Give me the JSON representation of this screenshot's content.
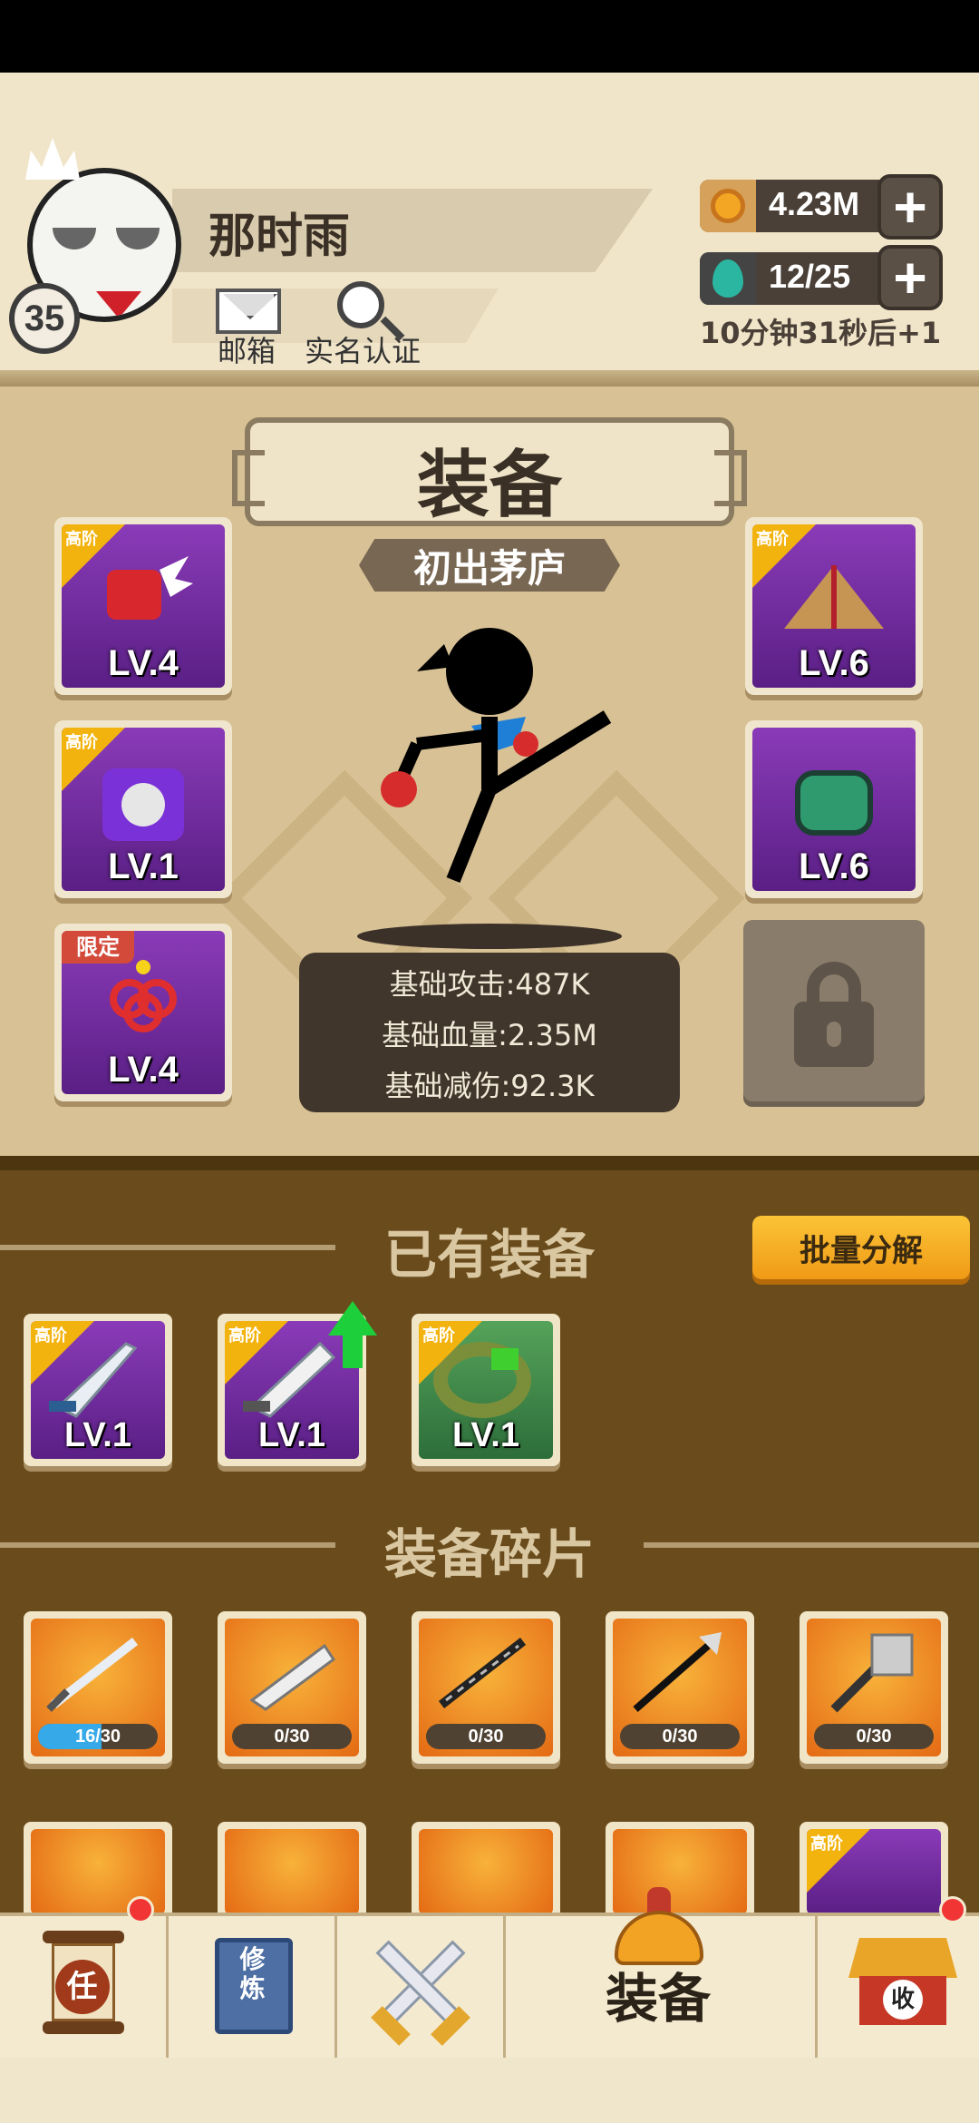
{
  "player": {
    "name": "那时雨",
    "level": "35",
    "mail_label": "邮箱",
    "verify_label": "实名认证"
  },
  "resources": {
    "gold": "4.23M",
    "gems": "12/25",
    "timer": "10分钟31秒后+1"
  },
  "equipment_panel": {
    "title": "装备",
    "rank": "初出茅庐",
    "left_slots": [
      {
        "badge": "高阶",
        "level": "LV.4",
        "icon": "red-gauntlet-icon"
      },
      {
        "badge": "高阶",
        "level": "LV.1",
        "icon": "purple-armor-icon"
      },
      {
        "badge": "限定",
        "level": "LV.4",
        "icon": "chinese-knot-icon"
      }
    ],
    "right_slots": [
      {
        "badge": "高阶",
        "level": "LV.6",
        "icon": "straw-hat-icon"
      },
      {
        "badge": "",
        "level": "LV.6",
        "icon": "green-bracer-icon"
      }
    ],
    "stats": [
      "基础攻击:487K",
      "基础血量:2.35M",
      "基础减伤:92.3K"
    ]
  },
  "owned": {
    "title": "已有装备",
    "batch_button": "批量分解",
    "items": [
      {
        "badge": "高阶",
        "level": "LV.1",
        "icon": "saber-icon"
      },
      {
        "badge": "高阶",
        "level": "LV.1",
        "icon": "saber-icon",
        "upgrade": true
      },
      {
        "badge": "高阶",
        "level": "LV.1",
        "icon": "jade-bracelet-icon"
      }
    ]
  },
  "fragments": {
    "title": "装备碎片",
    "items": [
      {
        "progress": "16/30",
        "fraction": 0.533,
        "icon": "sword-icon"
      },
      {
        "progress": "0/30",
        "fraction": 0,
        "icon": "broad-blade-icon"
      },
      {
        "progress": "0/30",
        "fraction": 0,
        "icon": "staff-icon"
      },
      {
        "progress": "0/30",
        "fraction": 0,
        "icon": "halberd-icon"
      },
      {
        "progress": "0/30",
        "fraction": 0,
        "icon": "war-hammer-icon"
      }
    ],
    "second_row_badge": "高阶"
  },
  "nav": {
    "task_char": "任",
    "train_label": "修炼",
    "equip_label": "装备",
    "shop_char": "收"
  },
  "colors": {
    "panel_bg": "#d8c194",
    "inventory_bg": "#6a4b1b",
    "accent_orange": "#f3b30e",
    "purple_tier": "#8a3bb8"
  }
}
